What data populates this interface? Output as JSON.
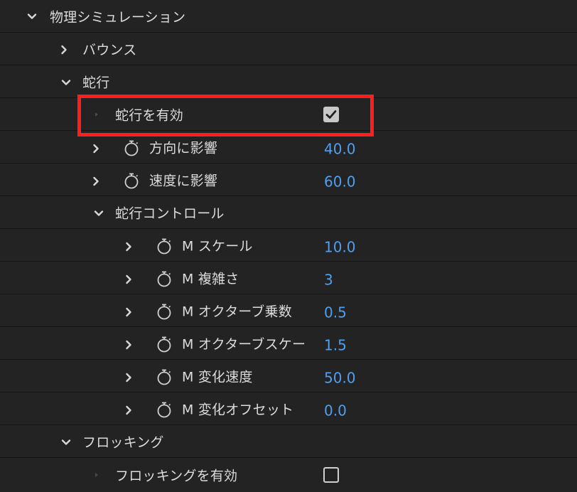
{
  "tree": {
    "physics": {
      "label": "物理シミュレーション",
      "expanded": true
    },
    "bounce": {
      "label": "バウンス",
      "expanded": false
    },
    "wander": {
      "label": "蛇行",
      "expanded": true
    },
    "wander_enable": {
      "label": "蛇行を有効",
      "checked": true
    },
    "affect_direction": {
      "label": "方向に影響",
      "value": "40.0"
    },
    "affect_speed": {
      "label": "速度に影響",
      "value": "60.0"
    },
    "wander_controls": {
      "label": "蛇行コントロール",
      "expanded": true
    },
    "m_scale": {
      "label": "M スケール",
      "value": "10.0"
    },
    "m_complexity": {
      "label": "M 複雑さ",
      "value": "3"
    },
    "m_octave_multiplier": {
      "label": "M オクターブ乗数",
      "value": "0.5"
    },
    "m_octave_scale": {
      "label": "M オクターブスケー",
      "value": "1.5"
    },
    "m_evolution_speed": {
      "label": "M 変化速度",
      "value": "50.0"
    },
    "m_evolution_offset": {
      "label": "M 変化オフセット",
      "value": "0.0"
    },
    "flocking": {
      "label": "フロッキング",
      "expanded": true
    },
    "flocking_enable": {
      "label": "フロッキングを有効",
      "checked": false
    }
  },
  "colors": {
    "background": "#232323",
    "value_blue": "#4f9ff1",
    "highlight_red": "#ff1e1e"
  }
}
